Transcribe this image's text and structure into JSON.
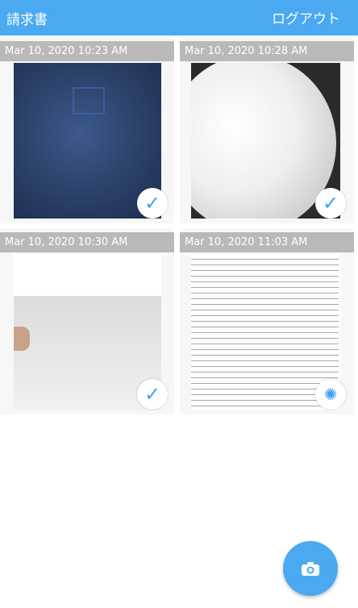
{
  "header": {
    "title": "請求書",
    "logout_label": "ログアウト"
  },
  "items": [
    {
      "timestamp": "Mar 10, 2020 10:23 AM",
      "status_icon": "check-icon"
    },
    {
      "timestamp": "Mar 10, 2020 10:28 AM",
      "status_icon": "check-icon"
    },
    {
      "timestamp": "Mar 10, 2020 10:30 AM",
      "status_icon": "check-icon"
    },
    {
      "timestamp": "Mar 10, 2020 11:03 AM",
      "status_icon": "loading-spinner-icon"
    }
  ],
  "fab": {
    "icon": "camera-icon"
  },
  "colors": {
    "accent": "#4aa9f0",
    "timestamp_bar": "#b9b9b9",
    "check": "#43a1ec"
  }
}
